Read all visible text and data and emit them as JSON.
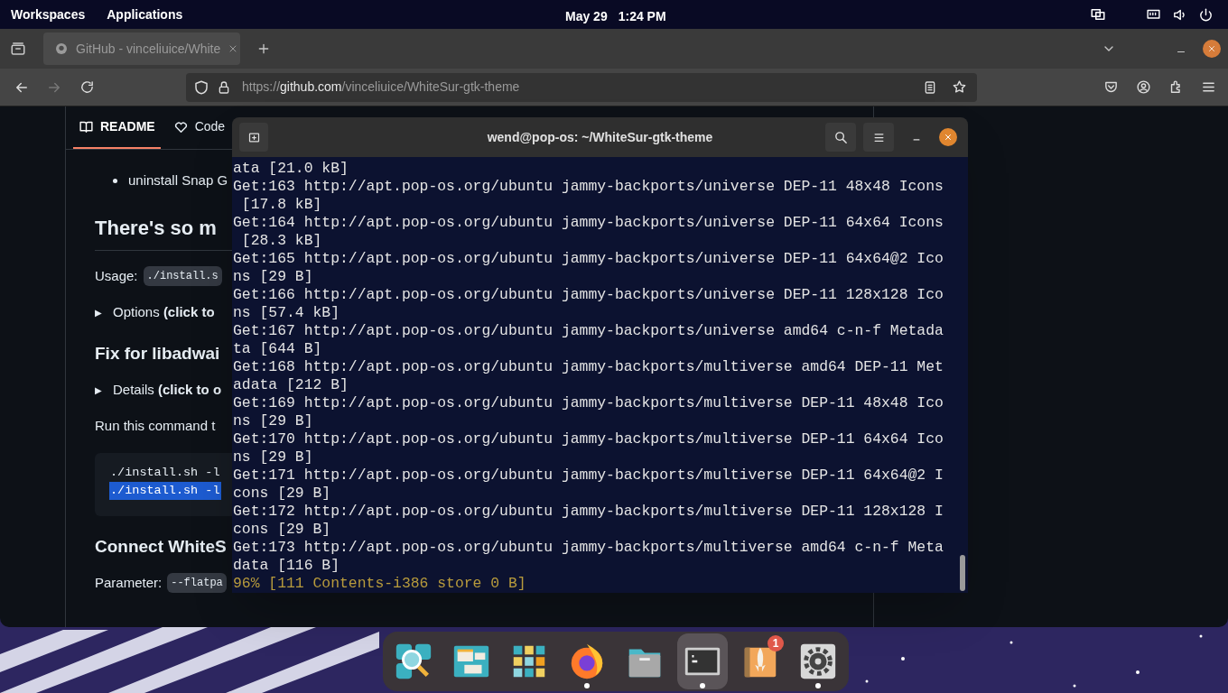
{
  "top_panel": {
    "menus": [
      "Workspaces",
      "Applications"
    ],
    "date": "May 29",
    "time": "1:24 PM"
  },
  "browser": {
    "tab": {
      "title": "GitHub - vinceliuice/White",
      "selected": true
    },
    "url": {
      "scheme": "https://",
      "host": "github.com",
      "path": "/vinceliuice/WhiteSur-gtk-theme"
    },
    "readme_tabs": [
      {
        "label": "README",
        "selected": true
      },
      {
        "label": "Code",
        "selected": false
      }
    ],
    "content": [
      {
        "kind": "bullet",
        "text": "uninstall Snap G"
      },
      {
        "kind": "heading",
        "text": "There's so m"
      },
      {
        "kind": "code_line",
        "label": "Usage:",
        "code": "./install.s"
      },
      {
        "kind": "details",
        "marker": "▶",
        "text": "Options **(click to**"
      },
      {
        "kind": "heading",
        "text": "Fix for libadwai"
      },
      {
        "kind": "details",
        "marker": "▶",
        "text": "Details **(click to o**"
      },
      {
        "kind": "paragraph",
        "text": "Run this command t"
      },
      {
        "kind": "code_block",
        "lines": [
          {
            "text": "./install.sh -l",
            "selected": false
          },
          {
            "text": "./install.sh -l",
            "selected": true
          }
        ]
      },
      {
        "kind": "heading",
        "text": "Connect WhiteS"
      },
      {
        "kind": "code_line",
        "label": "Parameter:",
        "code": "--flatpa"
      }
    ]
  },
  "terminal": {
    "title": "wend@pop-os: ~/WhiteSur-gtk-theme",
    "lines": [
      {
        "kind": "output",
        "text": "ata [21.0 kB]"
      },
      {
        "kind": "output",
        "text": "Get:163 http://apt.pop-os.org/ubuntu jammy-backports/universe DEP-11 48x48 Icons"
      },
      {
        "kind": "output",
        "text": " [17.8 kB]"
      },
      {
        "kind": "output",
        "text": "Get:164 http://apt.pop-os.org/ubuntu jammy-backports/universe DEP-11 64x64 Icons"
      },
      {
        "kind": "output",
        "text": " [28.3 kB]"
      },
      {
        "kind": "output",
        "text": "Get:165 http://apt.pop-os.org/ubuntu jammy-backports/universe DEP-11 64x64@2 Ico"
      },
      {
        "kind": "output",
        "text": "ns [29 B]"
      },
      {
        "kind": "output",
        "text": "Get:166 http://apt.pop-os.org/ubuntu jammy-backports/universe DEP-11 128x128 Ico"
      },
      {
        "kind": "output",
        "text": "ns [57.4 kB]"
      },
      {
        "kind": "output",
        "text": "Get:167 http://apt.pop-os.org/ubuntu jammy-backports/universe amd64 c-n-f Metada"
      },
      {
        "kind": "output",
        "text": "ta [644 B]"
      },
      {
        "kind": "output",
        "text": "Get:168 http://apt.pop-os.org/ubuntu jammy-backports/multiverse amd64 DEP-11 Met"
      },
      {
        "kind": "output",
        "text": "adata [212 B]"
      },
      {
        "kind": "output",
        "text": "Get:169 http://apt.pop-os.org/ubuntu jammy-backports/multiverse DEP-11 48x48 Ico"
      },
      {
        "kind": "output",
        "text": "ns [29 B]"
      },
      {
        "kind": "output",
        "text": "Get:170 http://apt.pop-os.org/ubuntu jammy-backports/multiverse DEP-11 64x64 Ico"
      },
      {
        "kind": "output",
        "text": "ns [29 B]"
      },
      {
        "kind": "output",
        "text": "Get:171 http://apt.pop-os.org/ubuntu jammy-backports/multiverse DEP-11 64x64@2 I"
      },
      {
        "kind": "output",
        "text": "cons [29 B]"
      },
      {
        "kind": "output",
        "text": "Get:172 http://apt.pop-os.org/ubuntu jammy-backports/multiverse DEP-11 128x128 I"
      },
      {
        "kind": "output",
        "text": "cons [29 B]"
      },
      {
        "kind": "output",
        "text": "Get:173 http://apt.pop-os.org/ubuntu jammy-backports/multiverse amd64 c-n-f Meta"
      },
      {
        "kind": "output",
        "text": "data [116 B]"
      },
      {
        "kind": "progress",
        "text": "96% [111 Contents-i386 store 0 B]"
      }
    ]
  },
  "dock": [
    {
      "kind": "search",
      "running": false,
      "selected": false
    },
    {
      "kind": "windows",
      "running": false,
      "selected": false
    },
    {
      "kind": "grid",
      "running": false,
      "selected": false
    },
    {
      "kind": "browser",
      "running": true,
      "selected": false
    },
    {
      "kind": "files",
      "running": false,
      "selected": false
    },
    {
      "kind": "terminal",
      "running": true,
      "selected": true
    },
    {
      "kind": "shop",
      "running": false,
      "selected": false,
      "badge": "1"
    },
    {
      "kind": "settings",
      "running": true,
      "selected": false
    }
  ]
}
